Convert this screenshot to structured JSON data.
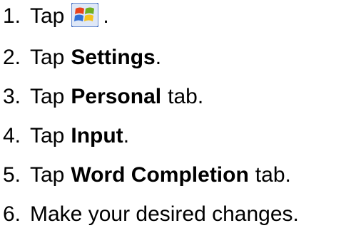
{
  "steps": [
    {
      "number": "1.",
      "prefix": "Tap",
      "icon": "windows-start-icon",
      "suffix": "."
    },
    {
      "number": "2.",
      "prefix": "Tap",
      "bold": "Settings",
      "suffix": "."
    },
    {
      "number": "3.",
      "prefix": "Tap",
      "bold": "Personal",
      "suffix": "tab."
    },
    {
      "number": "4.",
      "prefix": "Tap",
      "bold": "Input",
      "suffix": "."
    },
    {
      "number": "5.",
      "prefix": "Tap",
      "bold": "Word Completion",
      "suffix": "tab."
    },
    {
      "number": "6.",
      "text": "Make your desired changes."
    }
  ],
  "colors": {
    "flag_red": "#e8421c",
    "flag_green": "#6fb01f",
    "flag_blue": "#2f6fd6",
    "flag_yellow": "#f5c21b",
    "icon_outline": "#1c4fb5"
  }
}
